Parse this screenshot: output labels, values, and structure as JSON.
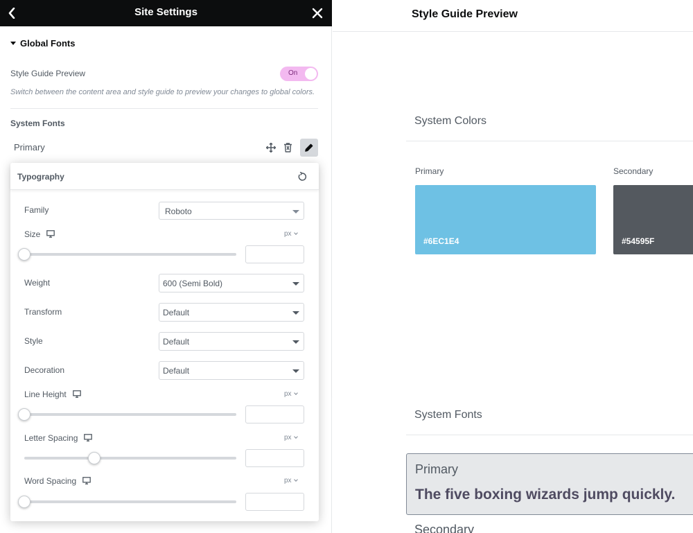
{
  "panel": {
    "title": "Site Settings",
    "section_title": "Global Fonts",
    "style_guide_preview": {
      "label": "Style Guide Preview",
      "toggle_text": "On",
      "description": "Switch between the content area and style guide to preview your changes to global colors."
    },
    "system_fonts_title": "System Fonts",
    "font_item_label": "Primary"
  },
  "typography": {
    "title": "Typography",
    "family": {
      "label": "Family",
      "value": "Roboto"
    },
    "size": {
      "label": "Size",
      "unit": "px",
      "slider_fraction": 0.0,
      "value": ""
    },
    "weight": {
      "label": "Weight",
      "value": "600 (Semi Bold)"
    },
    "transform": {
      "label": "Transform",
      "value": "Default"
    },
    "style": {
      "label": "Style",
      "value": "Default"
    },
    "decoration": {
      "label": "Decoration",
      "value": "Default"
    },
    "line_height": {
      "label": "Line Height",
      "unit": "px",
      "slider_fraction": 0.0,
      "value": ""
    },
    "letter_spacing": {
      "label": "Letter Spacing",
      "unit": "px",
      "slider_fraction": 0.33,
      "value": ""
    },
    "word_spacing": {
      "label": "Word Spacing",
      "unit": "px",
      "slider_fraction": 0.0,
      "value": ""
    }
  },
  "preview": {
    "title": "Style Guide Preview",
    "colors_title": "System Colors",
    "colors": [
      {
        "label": "Primary",
        "hex_text": "#6EC1E4",
        "color": "#6EC1E4"
      },
      {
        "label": "Secondary",
        "hex_text": "#54595F",
        "color": "#54595F"
      }
    ],
    "fonts_title": "System Fonts",
    "font_cards": [
      {
        "name": "Primary",
        "sample": "The five boxing wizards jump quickly."
      }
    ],
    "next_font_name": "Secondary"
  },
  "colors": {
    "header_bg": "#0c0d0e",
    "toggle_bg": "#f3b9f0",
    "text_primary": "#515962"
  }
}
